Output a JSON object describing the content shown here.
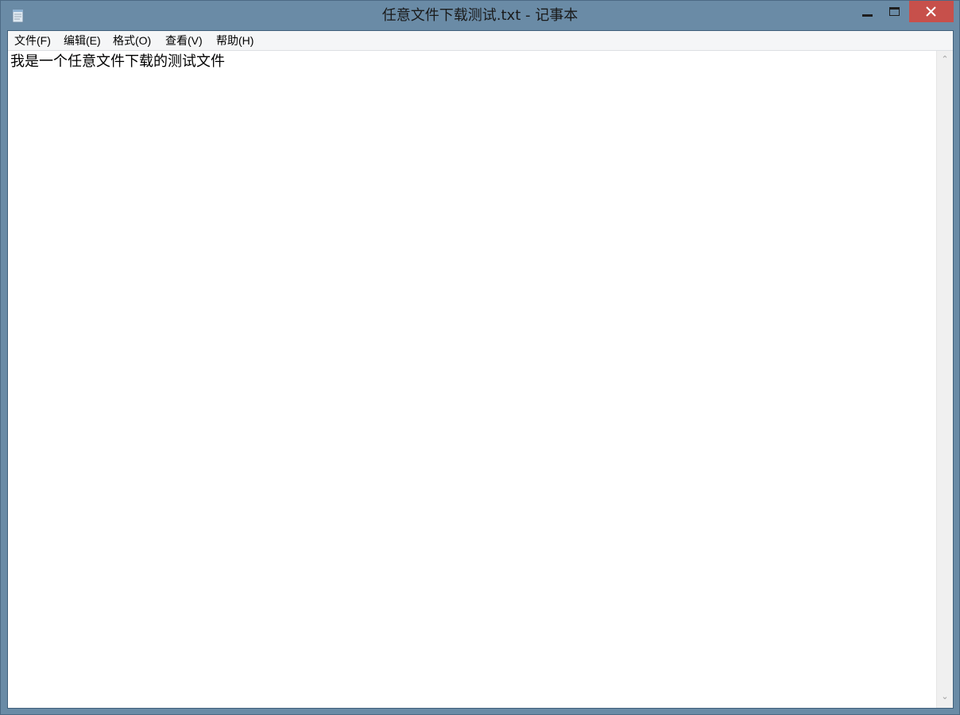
{
  "window": {
    "title": "任意文件下载测试.txt - 记事本",
    "app_icon": "notepad-icon",
    "close_color": "#c7504b",
    "frame_color": "#6a8ba6"
  },
  "menubar": {
    "items": [
      {
        "label": "文件(F)"
      },
      {
        "label": "编辑(E)"
      },
      {
        "label": "格式(O)"
      },
      {
        "label": "查看(V)"
      },
      {
        "label": "帮助(H)"
      }
    ]
  },
  "editor": {
    "content": "我是一个任意文件下载的测试文件"
  },
  "scrollbar": {
    "up_icon": "scroll-up-arrow-icon",
    "down_icon": "scroll-down-arrow-icon"
  }
}
